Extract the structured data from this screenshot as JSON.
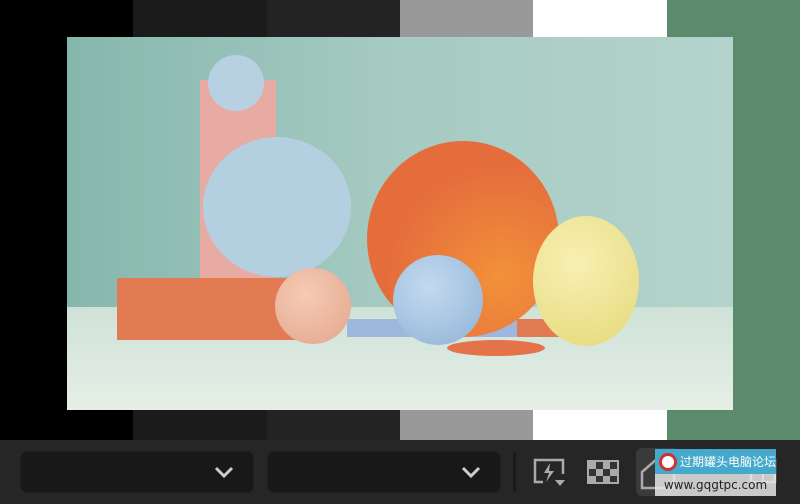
{
  "background_swatches": [
    "#000000",
    "#1b1b1b",
    "#232323",
    "#999999",
    "#ffffff",
    "#5b8a6d"
  ],
  "toolbar": {
    "dropdown_1": {
      "value": "",
      "icon": "chevron-down-icon"
    },
    "dropdown_2": {
      "value": "",
      "icon": "chevron-down-icon"
    },
    "buttons": [
      {
        "icon": "flash-screen-icon"
      },
      {
        "icon": "checkerboard-icon"
      },
      {
        "icon": "home-icon"
      },
      {
        "icon": "grid-icon"
      }
    ]
  },
  "watermark": {
    "title": "过期罐头电脑论坛",
    "url": "www.gqgtpc.com"
  }
}
